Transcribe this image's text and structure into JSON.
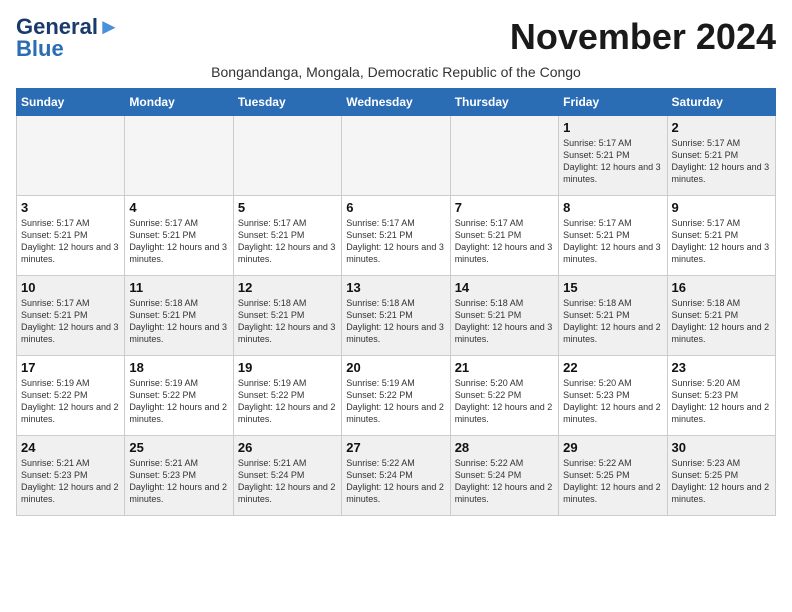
{
  "logo": {
    "line1": "General",
    "line2": "Blue"
  },
  "title": "November 2024",
  "subtitle": "Bongandanga, Mongala, Democratic Republic of the Congo",
  "days_of_week": [
    "Sunday",
    "Monday",
    "Tuesday",
    "Wednesday",
    "Thursday",
    "Friday",
    "Saturday"
  ],
  "rows": [
    [
      {
        "num": "",
        "info": "",
        "empty": true
      },
      {
        "num": "",
        "info": "",
        "empty": true
      },
      {
        "num": "",
        "info": "",
        "empty": true
      },
      {
        "num": "",
        "info": "",
        "empty": true
      },
      {
        "num": "",
        "info": "",
        "empty": true
      },
      {
        "num": "1",
        "info": "Sunrise: 5:17 AM\nSunset: 5:21 PM\nDaylight: 12 hours\nand 3 minutes."
      },
      {
        "num": "2",
        "info": "Sunrise: 5:17 AM\nSunset: 5:21 PM\nDaylight: 12 hours\nand 3 minutes."
      }
    ],
    [
      {
        "num": "3",
        "info": "Sunrise: 5:17 AM\nSunset: 5:21 PM\nDaylight: 12 hours\nand 3 minutes."
      },
      {
        "num": "4",
        "info": "Sunrise: 5:17 AM\nSunset: 5:21 PM\nDaylight: 12 hours\nand 3 minutes."
      },
      {
        "num": "5",
        "info": "Sunrise: 5:17 AM\nSunset: 5:21 PM\nDaylight: 12 hours\nand 3 minutes."
      },
      {
        "num": "6",
        "info": "Sunrise: 5:17 AM\nSunset: 5:21 PM\nDaylight: 12 hours\nand 3 minutes."
      },
      {
        "num": "7",
        "info": "Sunrise: 5:17 AM\nSunset: 5:21 PM\nDaylight: 12 hours\nand 3 minutes."
      },
      {
        "num": "8",
        "info": "Sunrise: 5:17 AM\nSunset: 5:21 PM\nDaylight: 12 hours\nand 3 minutes."
      },
      {
        "num": "9",
        "info": "Sunrise: 5:17 AM\nSunset: 5:21 PM\nDaylight: 12 hours\nand 3 minutes."
      }
    ],
    [
      {
        "num": "10",
        "info": "Sunrise: 5:17 AM\nSunset: 5:21 PM\nDaylight: 12 hours\nand 3 minutes."
      },
      {
        "num": "11",
        "info": "Sunrise: 5:18 AM\nSunset: 5:21 PM\nDaylight: 12 hours\nand 3 minutes."
      },
      {
        "num": "12",
        "info": "Sunrise: 5:18 AM\nSunset: 5:21 PM\nDaylight: 12 hours\nand 3 minutes."
      },
      {
        "num": "13",
        "info": "Sunrise: 5:18 AM\nSunset: 5:21 PM\nDaylight: 12 hours\nand 3 minutes."
      },
      {
        "num": "14",
        "info": "Sunrise: 5:18 AM\nSunset: 5:21 PM\nDaylight: 12 hours\nand 3 minutes."
      },
      {
        "num": "15",
        "info": "Sunrise: 5:18 AM\nSunset: 5:21 PM\nDaylight: 12 hours\nand 2 minutes."
      },
      {
        "num": "16",
        "info": "Sunrise: 5:18 AM\nSunset: 5:21 PM\nDaylight: 12 hours\nand 2 minutes."
      }
    ],
    [
      {
        "num": "17",
        "info": "Sunrise: 5:19 AM\nSunset: 5:22 PM\nDaylight: 12 hours\nand 2 minutes."
      },
      {
        "num": "18",
        "info": "Sunrise: 5:19 AM\nSunset: 5:22 PM\nDaylight: 12 hours\nand 2 minutes."
      },
      {
        "num": "19",
        "info": "Sunrise: 5:19 AM\nSunset: 5:22 PM\nDaylight: 12 hours\nand 2 minutes."
      },
      {
        "num": "20",
        "info": "Sunrise: 5:19 AM\nSunset: 5:22 PM\nDaylight: 12 hours\nand 2 minutes."
      },
      {
        "num": "21",
        "info": "Sunrise: 5:20 AM\nSunset: 5:22 PM\nDaylight: 12 hours\nand 2 minutes."
      },
      {
        "num": "22",
        "info": "Sunrise: 5:20 AM\nSunset: 5:23 PM\nDaylight: 12 hours\nand 2 minutes."
      },
      {
        "num": "23",
        "info": "Sunrise: 5:20 AM\nSunset: 5:23 PM\nDaylight: 12 hours\nand 2 minutes."
      }
    ],
    [
      {
        "num": "24",
        "info": "Sunrise: 5:21 AM\nSunset: 5:23 PM\nDaylight: 12 hours\nand 2 minutes."
      },
      {
        "num": "25",
        "info": "Sunrise: 5:21 AM\nSunset: 5:23 PM\nDaylight: 12 hours\nand 2 minutes."
      },
      {
        "num": "26",
        "info": "Sunrise: 5:21 AM\nSunset: 5:24 PM\nDaylight: 12 hours\nand 2 minutes."
      },
      {
        "num": "27",
        "info": "Sunrise: 5:22 AM\nSunset: 5:24 PM\nDaylight: 12 hours\nand 2 minutes."
      },
      {
        "num": "28",
        "info": "Sunrise: 5:22 AM\nSunset: 5:24 PM\nDaylight: 12 hours\nand 2 minutes."
      },
      {
        "num": "29",
        "info": "Sunrise: 5:22 AM\nSunset: 5:25 PM\nDaylight: 12 hours\nand 2 minutes."
      },
      {
        "num": "30",
        "info": "Sunrise: 5:23 AM\nSunset: 5:25 PM\nDaylight: 12 hours\nand 2 minutes."
      }
    ]
  ]
}
